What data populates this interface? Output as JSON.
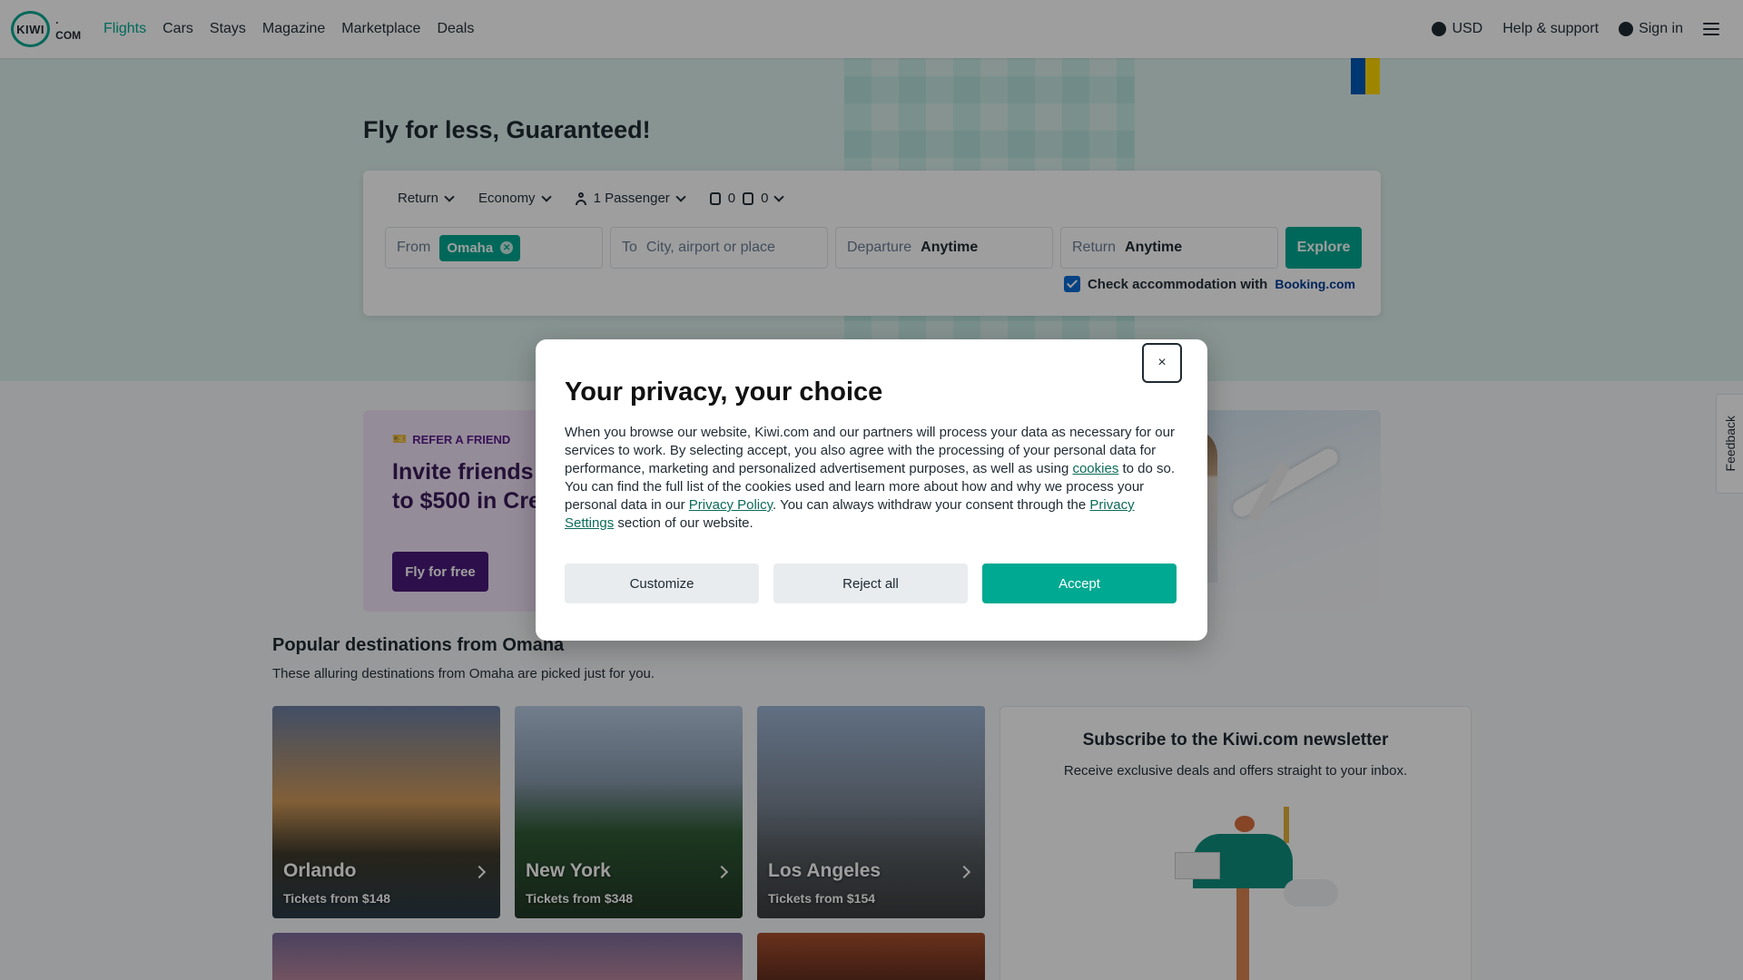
{
  "header": {
    "logo_text": "KIWI",
    "logo_suffix": "· COM",
    "nav": [
      "Flights",
      "Cars",
      "Stays",
      "Magazine",
      "Marketplace",
      "Deals"
    ],
    "active_nav": "Flights",
    "currency": "USD",
    "help": "Help & support",
    "signin": "Sign in"
  },
  "hero": {
    "title": "Fly for less, Guaranteed!",
    "options": {
      "trip_type": "Return",
      "cabin": "Economy",
      "passengers": "1 Passenger",
      "cabin_bags": "0",
      "checked_bags": "0"
    },
    "fields": {
      "from_label": "From",
      "from_value": "Omaha",
      "to_label": "To",
      "to_placeholder": "City, airport or place",
      "departure_label": "Departure",
      "departure_value": "Anytime",
      "return_label": "Return",
      "return_value": "Anytime"
    },
    "explore_label": "Explore",
    "accommodation_label": "Check accommodation with",
    "accommodation_brand": "Booking.com"
  },
  "refer": {
    "tag": "REFER A FRIEND",
    "title_line1": "Invite friends t",
    "title_line2": "to $500 in Cre",
    "button": "Fly for free"
  },
  "popular": {
    "title": "Popular destinations from Omaha",
    "subtitle": "These alluring destinations from Omaha are picked just for you.",
    "cards": [
      {
        "name": "Orlando",
        "price": "Tickets from $148"
      },
      {
        "name": "New York",
        "price": "Tickets from $348"
      },
      {
        "name": "Los Angeles",
        "price": "Tickets from $154"
      }
    ]
  },
  "newsletter": {
    "title": "Subscribe to the Kiwi.com newsletter",
    "subtitle": "Receive exclusive deals and offers straight to your inbox."
  },
  "feedback": "Feedback",
  "modal": {
    "title": "Your privacy, your choice",
    "body_1": "When you browse our website, Kiwi.com and our partners will process your data as necessary for our services to work. By selecting accept, you also agree with the processing of your personal data for performance, marketing and personalized advertisement purposes, as well as using ",
    "link_cookies": "cookies",
    "body_2": " to do so. You can find the full list of the cookies used and learn more about how and why we process your personal data in our ",
    "link_privacy_policy": "Privacy Policy",
    "body_3": ". You can always withdraw your consent through the ",
    "link_privacy_settings": "Privacy Settings",
    "body_4": " section of our website.",
    "customize": "Customize",
    "reject": "Reject all",
    "accept": "Accept",
    "close": "×"
  },
  "colors": {
    "accent": "#00a991",
    "refer_purple": "#4a1a7a",
    "booking_blue": "#003b95"
  }
}
